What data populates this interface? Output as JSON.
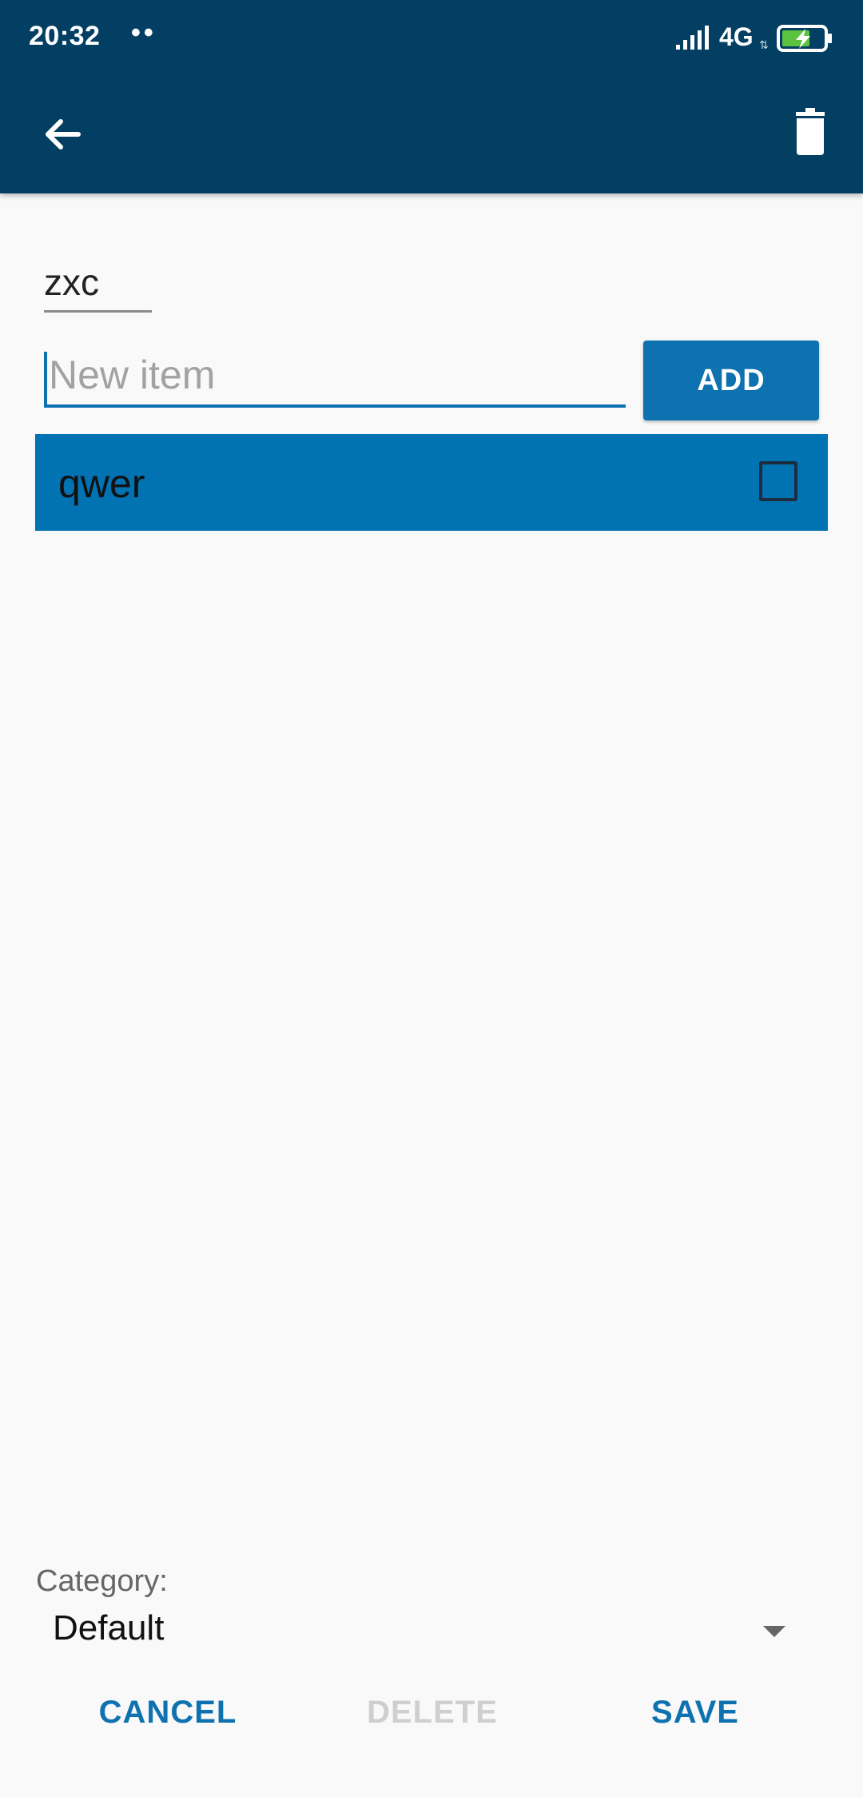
{
  "status_bar": {
    "time": "20:32",
    "dots": "••",
    "network": "4G"
  },
  "toolbar": {
    "back_icon": "arrow-back-icon",
    "delete_icon": "trash-icon"
  },
  "list": {
    "title": "zxc",
    "new_item_placeholder": "New item",
    "add_label": "ADD",
    "items": [
      {
        "label": "qwer",
        "checked": false
      }
    ]
  },
  "category": {
    "label": "Category:",
    "selected": "Default"
  },
  "actions": {
    "cancel_label": "CANCEL",
    "delete_label": "DELETE",
    "save_label": "SAVE"
  },
  "colors": {
    "app_bar": "#023f63",
    "accent": "#0f72b0",
    "selected_row": "#0172b2",
    "disabled_text": "#cfcfcf"
  }
}
